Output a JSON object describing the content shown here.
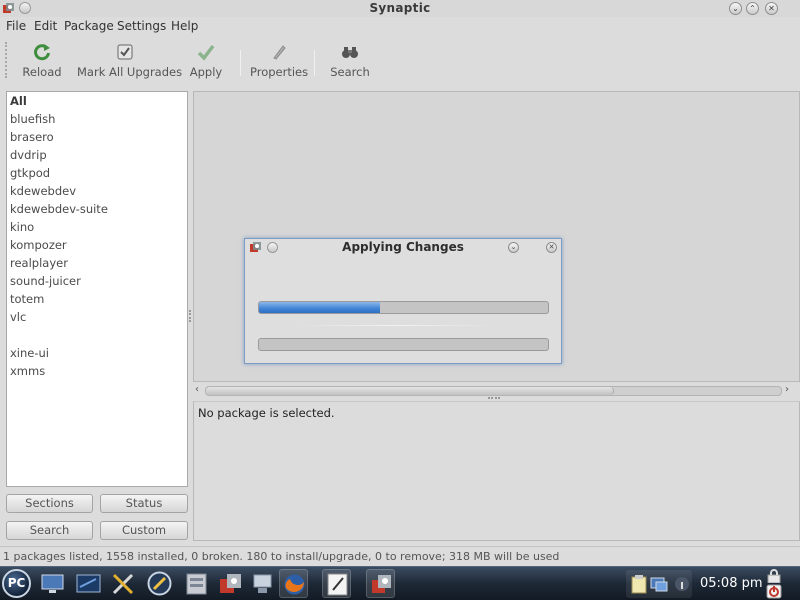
{
  "window": {
    "title": "Synaptic"
  },
  "menu": [
    "File",
    "Edit",
    "Package",
    "Settings",
    "Help"
  ],
  "toolbar": {
    "reload": "Reload",
    "mark_all_upgrades": "Mark All Upgrades",
    "apply": "Apply",
    "properties": "Properties",
    "search": "Search"
  },
  "filters": [
    "All",
    "bluefish",
    "brasero",
    "dvdrip",
    "gtkpod",
    "kdewebdev",
    "kdewebdev-suite",
    "kino",
    "kompozer",
    "realplayer",
    "sound-juicer",
    "totem",
    "vlc",
    "xine-ui",
    "xmms"
  ],
  "panel_buttons": {
    "sections": "Sections",
    "status": "Status",
    "search": "Search",
    "custom": "Custom"
  },
  "details": {
    "text": "No package is selected."
  },
  "dialog": {
    "title": "Applying Changes",
    "progress1": 0.42,
    "progress2": 0.0
  },
  "status": {
    "text": "1 packages listed, 1558 installed, 0 broken. 180 to install/upgrade, 0 to remove; 318 MB will be used"
  },
  "taskbar": {
    "start_label": "PC",
    "clock": "05:08 pm"
  },
  "colors": {
    "accent": "#3f84d6",
    "taskbar": "#1e2937"
  }
}
